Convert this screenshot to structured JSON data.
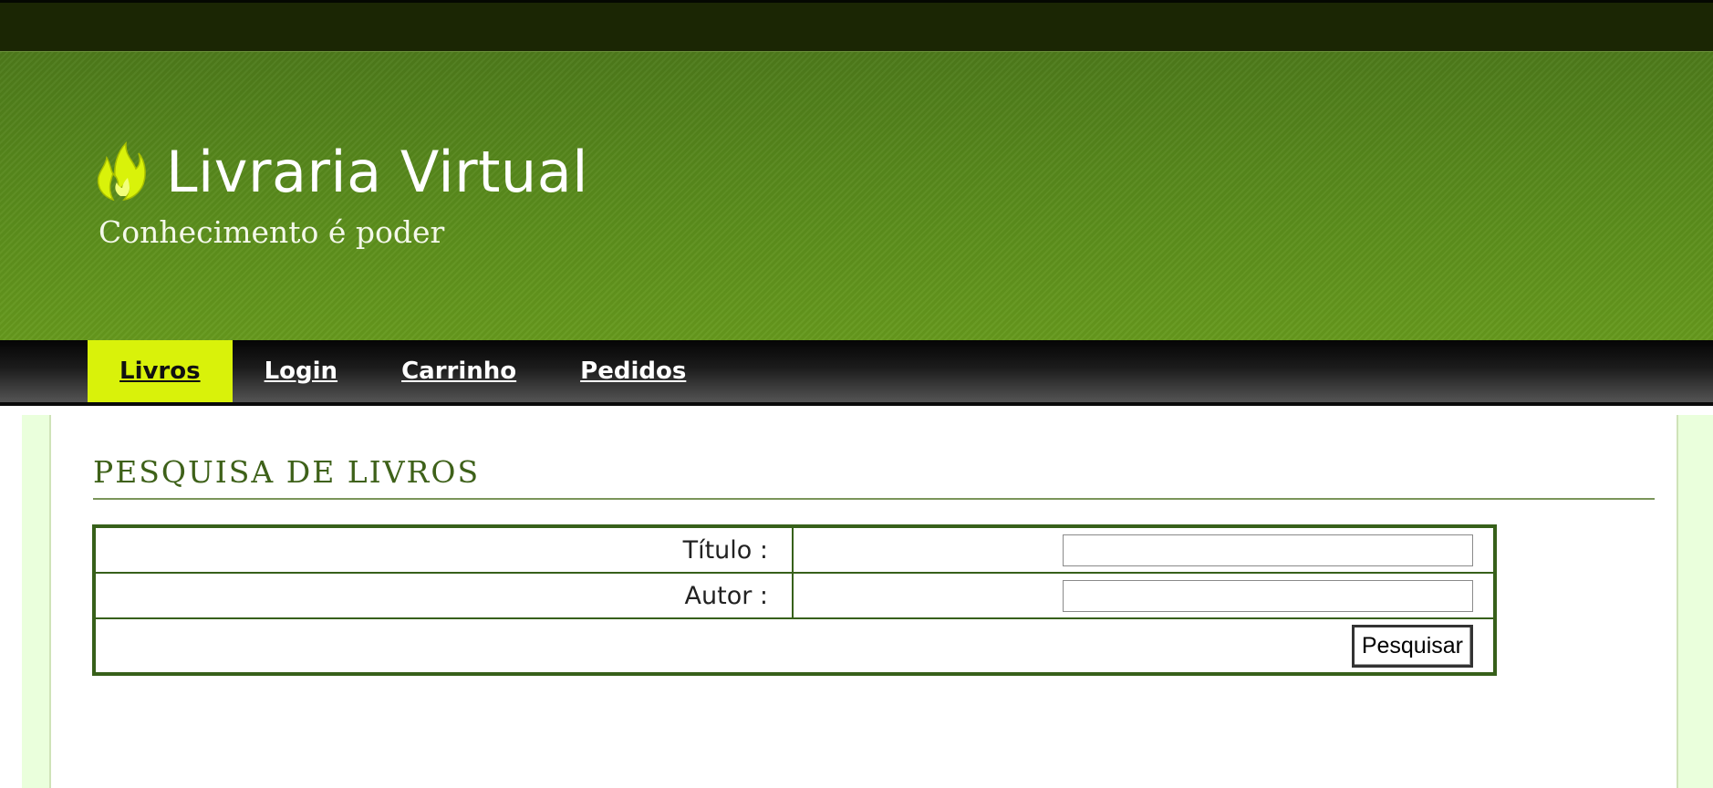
{
  "header": {
    "site_title": "Livraria Virtual",
    "tagline": "Conhecimento é poder",
    "logo_icon": "flame-icon",
    "colors": {
      "header_green": "#5a8c1c",
      "logo_yellow": "#d9f20a"
    }
  },
  "nav": {
    "items": [
      {
        "label": "Livros",
        "active": true
      },
      {
        "label": "Login",
        "active": false
      },
      {
        "label": "Carrinho",
        "active": false
      },
      {
        "label": "Pedidos",
        "active": false
      }
    ],
    "active_color": "#d9f20a"
  },
  "main": {
    "title": "PESQUISA DE LIVROS",
    "form": {
      "fields": [
        {
          "label": "Título :",
          "value": "",
          "placeholder": ""
        },
        {
          "label": "Autor :",
          "value": "",
          "placeholder": ""
        }
      ],
      "submit_label": "Pesquisar"
    }
  }
}
